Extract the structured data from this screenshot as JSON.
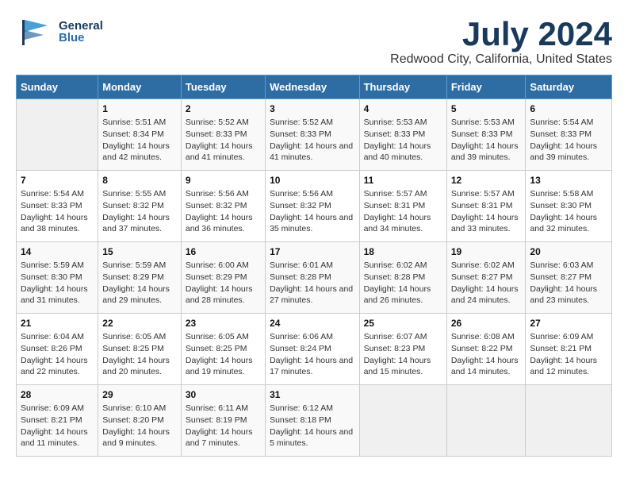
{
  "header": {
    "logo_general": "General",
    "logo_blue": "Blue",
    "title": "July 2024",
    "subtitle": "Redwood City, California, United States"
  },
  "calendar": {
    "days_of_week": [
      "Sunday",
      "Monday",
      "Tuesday",
      "Wednesday",
      "Thursday",
      "Friday",
      "Saturday"
    ],
    "weeks": [
      [
        {
          "day": "",
          "sunrise": "",
          "sunset": "",
          "daylight": "",
          "empty": true
        },
        {
          "day": "1",
          "sunrise": "Sunrise: 5:51 AM",
          "sunset": "Sunset: 8:34 PM",
          "daylight": "Daylight: 14 hours and 42 minutes."
        },
        {
          "day": "2",
          "sunrise": "Sunrise: 5:52 AM",
          "sunset": "Sunset: 8:33 PM",
          "daylight": "Daylight: 14 hours and 41 minutes."
        },
        {
          "day": "3",
          "sunrise": "Sunrise: 5:52 AM",
          "sunset": "Sunset: 8:33 PM",
          "daylight": "Daylight: 14 hours and 41 minutes."
        },
        {
          "day": "4",
          "sunrise": "Sunrise: 5:53 AM",
          "sunset": "Sunset: 8:33 PM",
          "daylight": "Daylight: 14 hours and 40 minutes."
        },
        {
          "day": "5",
          "sunrise": "Sunrise: 5:53 AM",
          "sunset": "Sunset: 8:33 PM",
          "daylight": "Daylight: 14 hours and 39 minutes."
        },
        {
          "day": "6",
          "sunrise": "Sunrise: 5:54 AM",
          "sunset": "Sunset: 8:33 PM",
          "daylight": "Daylight: 14 hours and 39 minutes."
        }
      ],
      [
        {
          "day": "7",
          "sunrise": "Sunrise: 5:54 AM",
          "sunset": "Sunset: 8:33 PM",
          "daylight": "Daylight: 14 hours and 38 minutes."
        },
        {
          "day": "8",
          "sunrise": "Sunrise: 5:55 AM",
          "sunset": "Sunset: 8:32 PM",
          "daylight": "Daylight: 14 hours and 37 minutes."
        },
        {
          "day": "9",
          "sunrise": "Sunrise: 5:56 AM",
          "sunset": "Sunset: 8:32 PM",
          "daylight": "Daylight: 14 hours and 36 minutes."
        },
        {
          "day": "10",
          "sunrise": "Sunrise: 5:56 AM",
          "sunset": "Sunset: 8:32 PM",
          "daylight": "Daylight: 14 hours and 35 minutes."
        },
        {
          "day": "11",
          "sunrise": "Sunrise: 5:57 AM",
          "sunset": "Sunset: 8:31 PM",
          "daylight": "Daylight: 14 hours and 34 minutes."
        },
        {
          "day": "12",
          "sunrise": "Sunrise: 5:57 AM",
          "sunset": "Sunset: 8:31 PM",
          "daylight": "Daylight: 14 hours and 33 minutes."
        },
        {
          "day": "13",
          "sunrise": "Sunrise: 5:58 AM",
          "sunset": "Sunset: 8:30 PM",
          "daylight": "Daylight: 14 hours and 32 minutes."
        }
      ],
      [
        {
          "day": "14",
          "sunrise": "Sunrise: 5:59 AM",
          "sunset": "Sunset: 8:30 PM",
          "daylight": "Daylight: 14 hours and 31 minutes."
        },
        {
          "day": "15",
          "sunrise": "Sunrise: 5:59 AM",
          "sunset": "Sunset: 8:29 PM",
          "daylight": "Daylight: 14 hours and 29 minutes."
        },
        {
          "day": "16",
          "sunrise": "Sunrise: 6:00 AM",
          "sunset": "Sunset: 8:29 PM",
          "daylight": "Daylight: 14 hours and 28 minutes."
        },
        {
          "day": "17",
          "sunrise": "Sunrise: 6:01 AM",
          "sunset": "Sunset: 8:28 PM",
          "daylight": "Daylight: 14 hours and 27 minutes."
        },
        {
          "day": "18",
          "sunrise": "Sunrise: 6:02 AM",
          "sunset": "Sunset: 8:28 PM",
          "daylight": "Daylight: 14 hours and 26 minutes."
        },
        {
          "day": "19",
          "sunrise": "Sunrise: 6:02 AM",
          "sunset": "Sunset: 8:27 PM",
          "daylight": "Daylight: 14 hours and 24 minutes."
        },
        {
          "day": "20",
          "sunrise": "Sunrise: 6:03 AM",
          "sunset": "Sunset: 8:27 PM",
          "daylight": "Daylight: 14 hours and 23 minutes."
        }
      ],
      [
        {
          "day": "21",
          "sunrise": "Sunrise: 6:04 AM",
          "sunset": "Sunset: 8:26 PM",
          "daylight": "Daylight: 14 hours and 22 minutes."
        },
        {
          "day": "22",
          "sunrise": "Sunrise: 6:05 AM",
          "sunset": "Sunset: 8:25 PM",
          "daylight": "Daylight: 14 hours and 20 minutes."
        },
        {
          "day": "23",
          "sunrise": "Sunrise: 6:05 AM",
          "sunset": "Sunset: 8:25 PM",
          "daylight": "Daylight: 14 hours and 19 minutes."
        },
        {
          "day": "24",
          "sunrise": "Sunrise: 6:06 AM",
          "sunset": "Sunset: 8:24 PM",
          "daylight": "Daylight: 14 hours and 17 minutes."
        },
        {
          "day": "25",
          "sunrise": "Sunrise: 6:07 AM",
          "sunset": "Sunset: 8:23 PM",
          "daylight": "Daylight: 14 hours and 15 minutes."
        },
        {
          "day": "26",
          "sunrise": "Sunrise: 6:08 AM",
          "sunset": "Sunset: 8:22 PM",
          "daylight": "Daylight: 14 hours and 14 minutes."
        },
        {
          "day": "27",
          "sunrise": "Sunrise: 6:09 AM",
          "sunset": "Sunset: 8:21 PM",
          "daylight": "Daylight: 14 hours and 12 minutes."
        }
      ],
      [
        {
          "day": "28",
          "sunrise": "Sunrise: 6:09 AM",
          "sunset": "Sunset: 8:21 PM",
          "daylight": "Daylight: 14 hours and 11 minutes."
        },
        {
          "day": "29",
          "sunrise": "Sunrise: 6:10 AM",
          "sunset": "Sunset: 8:20 PM",
          "daylight": "Daylight: 14 hours and 9 minutes."
        },
        {
          "day": "30",
          "sunrise": "Sunrise: 6:11 AM",
          "sunset": "Sunset: 8:19 PM",
          "daylight": "Daylight: 14 hours and 7 minutes."
        },
        {
          "day": "31",
          "sunrise": "Sunrise: 6:12 AM",
          "sunset": "Sunset: 8:18 PM",
          "daylight": "Daylight: 14 hours and 5 minutes."
        },
        {
          "day": "",
          "sunrise": "",
          "sunset": "",
          "daylight": "",
          "empty": true
        },
        {
          "day": "",
          "sunrise": "",
          "sunset": "",
          "daylight": "",
          "empty": true
        },
        {
          "day": "",
          "sunrise": "",
          "sunset": "",
          "daylight": "",
          "empty": true
        }
      ]
    ]
  }
}
